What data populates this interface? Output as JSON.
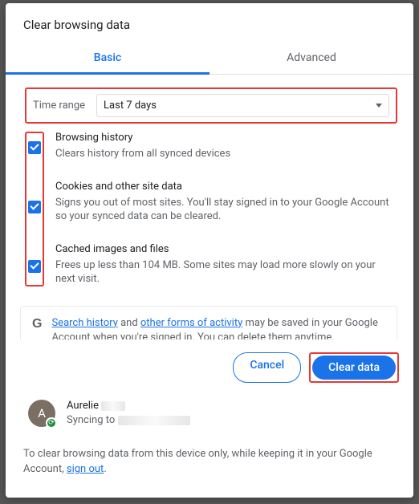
{
  "title": "Clear browsing data",
  "tabs": {
    "basic": "Basic",
    "advanced": "Advanced"
  },
  "timeRange": {
    "label": "Time range",
    "value": "Last 7 days"
  },
  "items": [
    {
      "title": "Browsing history",
      "desc": "Clears history from all synced devices"
    },
    {
      "title": "Cookies and other site data",
      "desc": "Signs you out of most sites. You'll stay signed in to your Google Account so your synced data can be cleared."
    },
    {
      "title": "Cached images and files",
      "desc": "Frees up less than 104 MB. Some sites may load more slowly on your next visit."
    }
  ],
  "info": {
    "link1": "Search history",
    "mid1": " and ",
    "link2": "other forms of activity",
    "rest": " may be saved in your Google Account when you're signed in. You can delete them anytime."
  },
  "buttons": {
    "cancel": "Cancel",
    "clear": "Clear data"
  },
  "profile": {
    "initial": "A",
    "name": "Aurelie",
    "syncLine": "Syncing to"
  },
  "footer": {
    "pre": "To clear browsing data from this device only, while keeping it in your Google Account, ",
    "link": "sign out",
    "post": "."
  }
}
